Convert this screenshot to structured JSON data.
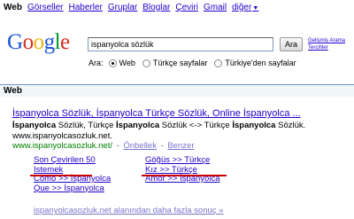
{
  "topnav": {
    "current": "Web",
    "links": [
      "Görseller",
      "Haberler",
      "Gruplar",
      "Bloglar",
      "Çeviri",
      "Gmail",
      "diğer"
    ],
    "more_arrow": "▼"
  },
  "logo": {
    "letters": [
      "G",
      "o",
      "o",
      "g",
      "l",
      "e"
    ]
  },
  "search": {
    "query": "ispanyolca sözlük",
    "button_label": "Ara",
    "advanced_link": "Gelişmiş Arama",
    "preferences_link": "Tercihler"
  },
  "scope": {
    "label": "Ara:",
    "options": [
      "Web",
      "Türkçe sayfalar",
      "Türkiye'den sayfalar"
    ],
    "selected": "Web"
  },
  "results_bar": {
    "label": "Web"
  },
  "result": {
    "title": "İspanyolca Sözlük, İspanyolca Türkçe Sözlük, Online İspanyolca ...",
    "snippet_bold_1": "İspanyolca",
    "snippet_text_1": " Sözlük, Türkçe ",
    "snippet_bold_2": "İspanyolca",
    "snippet_text_2": " Sözlük <-> Türkçe ",
    "snippet_bold_3": "İspanyolca",
    "snippet_text_3": " Sözlük.",
    "snippet_line_2": "www.ispanyolcasozluk.net.",
    "url": "www.ispanyolcasozluk.net/",
    "cache_separator": " - ",
    "cached": "Önbellek",
    "similar_separator": " - ",
    "similar": "Benzer"
  },
  "sitelinks": {
    "col1": [
      "Son Çevirilen 50",
      "Istemek",
      "Como >> İspanyolca",
      "Que >> İspanyolca"
    ],
    "col2": [
      "Göğüs >> Türkçe",
      "Kız >> Türkçe",
      "Amor >> İspanyolca"
    ]
  },
  "more_results": "ispanyolcasozluk.net alanından daha fazla sonuç »",
  "colors": {
    "link": "#2200cc",
    "url_green": "#008000",
    "annotation_red": "#cc0000",
    "bar_border": "#6b90da"
  }
}
